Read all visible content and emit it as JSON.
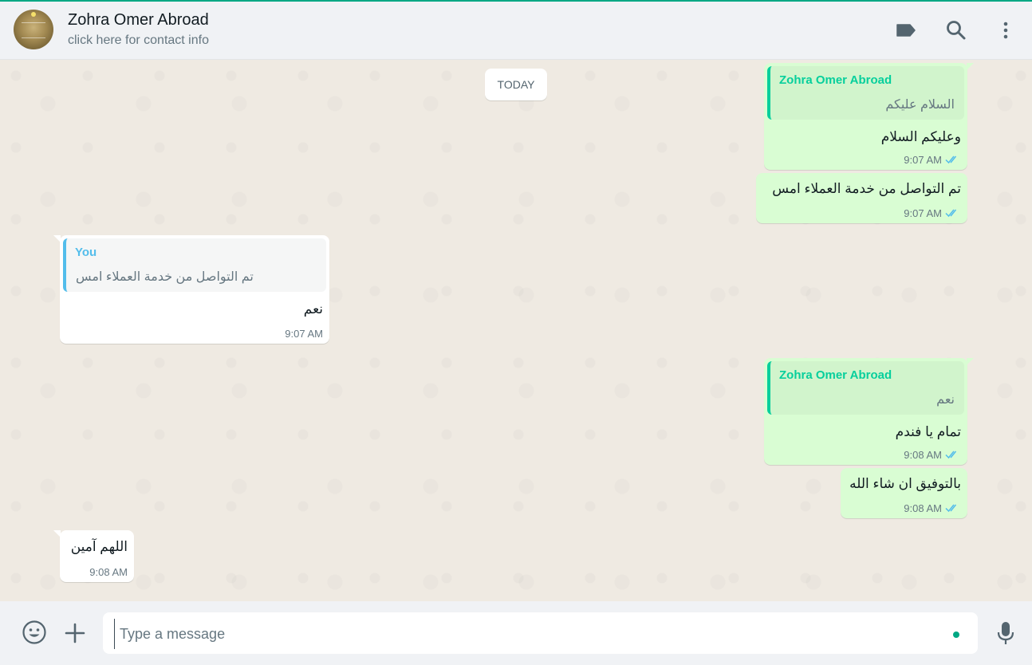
{
  "header": {
    "contact_name": "Zohra Omer Abroad",
    "contact_subtitle": "click here for contact info",
    "icons": [
      "label-icon",
      "search-icon",
      "menu-icon"
    ]
  },
  "chat": {
    "date_divider": "TODAY",
    "messages": [
      {
        "direction": "outgoing",
        "quote_author": "Zohra Omer Abroad",
        "quote_text": "السلام عليكم",
        "text": "وعليكم السلام",
        "time": "9:07 AM",
        "status": "read"
      },
      {
        "direction": "outgoing",
        "text": "تم التواصل من خدمة العملاء امس",
        "time": "9:07 AM",
        "status": "read"
      },
      {
        "direction": "incoming",
        "quote_author": "You",
        "quote_text": "تم التواصل من خدمة العملاء امس",
        "text": "نعم",
        "time": "9:07 AM"
      },
      {
        "direction": "outgoing",
        "quote_author": "Zohra Omer Abroad",
        "quote_text": "نعم",
        "text": "تمام يا فندم",
        "time": "9:08 AM",
        "status": "read"
      },
      {
        "direction": "outgoing",
        "text": "بالتوفيق ان شاء الله",
        "time": "9:08 AM",
        "status": "read"
      },
      {
        "direction": "incoming",
        "text": "اللهم آمين",
        "time": "9:08 AM"
      }
    ]
  },
  "footer": {
    "placeholder": "Type a message",
    "value": "",
    "icons": [
      "emoji-icon",
      "attach-plus-icon",
      "microphone-icon"
    ]
  },
  "colors": {
    "accent": "#00a884",
    "outgoing_bubble": "#d9fdd3",
    "incoming_bubble": "#ffffff",
    "read_ticks": "#53bdeb",
    "chat_background": "#efeae2"
  }
}
